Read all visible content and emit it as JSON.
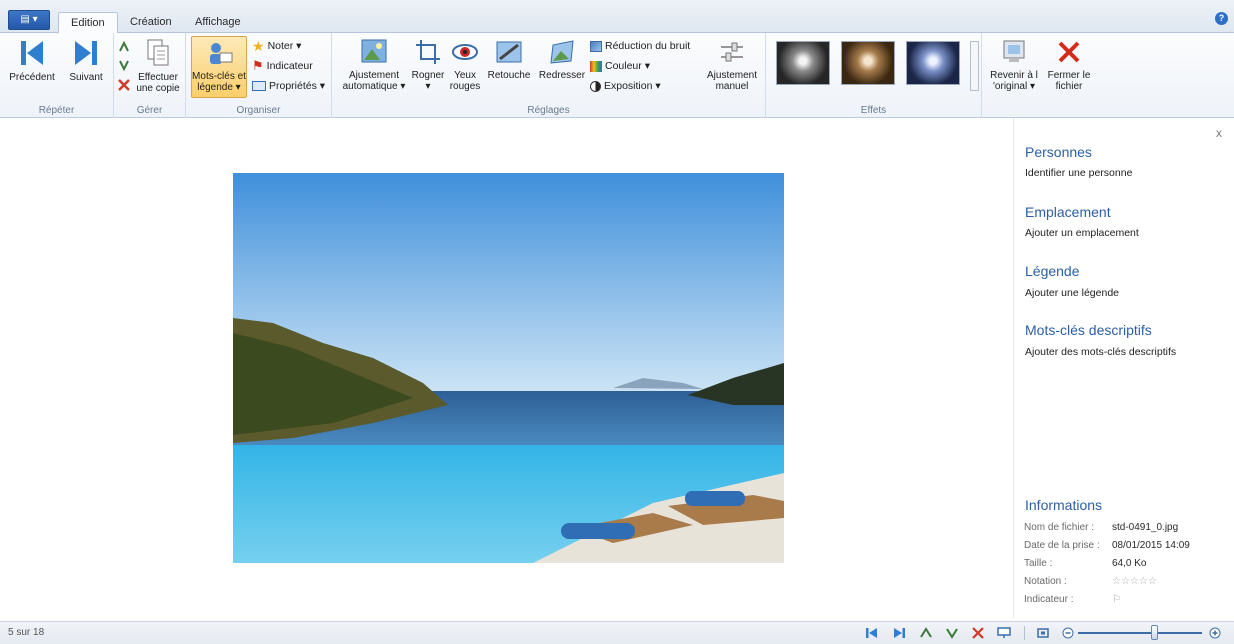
{
  "tabs": [
    "Edition",
    "Création",
    "Affichage"
  ],
  "ribbon": {
    "previous_label": "Précédent",
    "next_label": "Suivant",
    "group_repeat": "Répéter",
    "copy_label_1": "Effectuer",
    "copy_label_2": "une copie",
    "group_manage": "Gérer",
    "keywords_label_1": "Mots-clés et",
    "keywords_label_2": "légende ▾",
    "rate_label": "Noter ▾",
    "flag_label": "Indicateur",
    "properties_label": "Propriétés ▾",
    "group_organize": "Organiser",
    "autoadjust_label_1": "Ajustement",
    "autoadjust_label_2": "automatique ▾",
    "crop_label_1": "Rogner",
    "crop_label_2": "▾",
    "redeye_label_1": "Yeux",
    "redeye_label_2": "rouges",
    "retouch_label": "Retouche",
    "straighten_label": "Redresser",
    "noise_label": "Réduction du bruit",
    "color_label": "Couleur ▾",
    "exposure_label": "Exposition ▾",
    "manual_label_1": "Ajustement",
    "manual_label_2": "manuel",
    "group_adjust": "Réglages",
    "group_effects": "Effets",
    "revert_label_1": "Revenir à l",
    "revert_label_2": "'original ▾",
    "close_file_label_1": "Fermer le",
    "close_file_label_2": "fichier"
  },
  "panel": {
    "close": "x",
    "people_title": "Personnes",
    "people_link": "Identifier une personne",
    "location_title": "Emplacement",
    "location_link": "Ajouter un emplacement",
    "caption_title": "Légende",
    "caption_link": "Ajouter une légende",
    "tags_title": "Mots-clés descriptifs",
    "tags_link": "Ajouter des mots-clés descriptifs",
    "info_title": "Informations",
    "info": [
      {
        "k": "Nom de fichier :",
        "v": "std-0491_0.jpg"
      },
      {
        "k": "Date de la prise :",
        "v": "08/01/2015 14:09"
      },
      {
        "k": "Taille :",
        "v": "64,0 Ko"
      },
      {
        "k": "Notation :",
        "v": "☆☆☆☆☆"
      },
      {
        "k": "Indicateur :",
        "v": "⚐"
      }
    ]
  },
  "status": {
    "count": "5 sur 18"
  },
  "colors": {
    "accent": "#2b5fa6",
    "selected": "#fbcf6a"
  }
}
